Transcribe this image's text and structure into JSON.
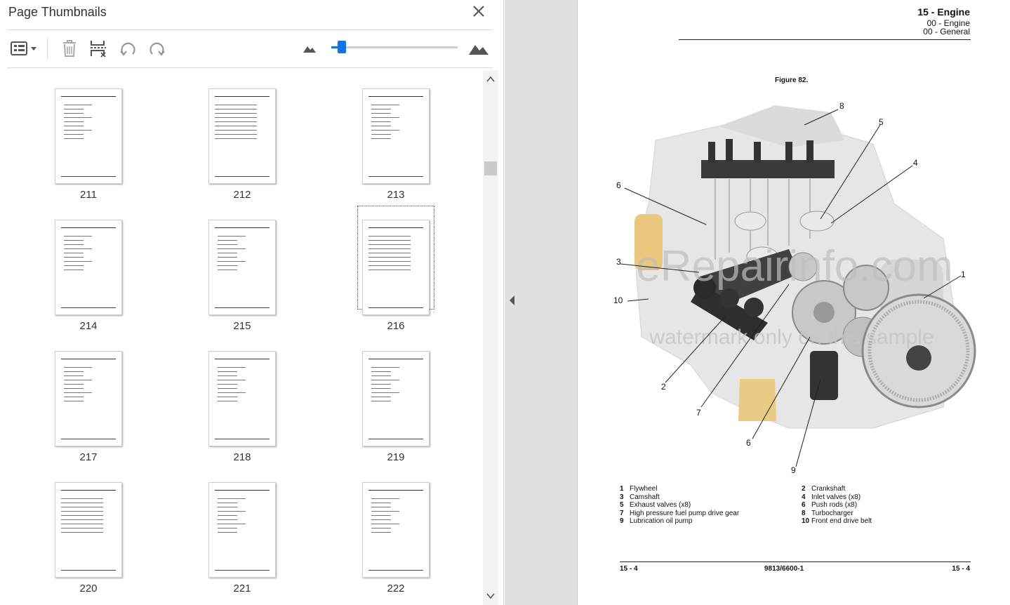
{
  "panel": {
    "title": "Page Thumbnails",
    "thumbnails": [
      {
        "page": "211"
      },
      {
        "page": "212"
      },
      {
        "page": "213"
      },
      {
        "page": "214"
      },
      {
        "page": "215"
      },
      {
        "page": "216",
        "selected": true
      },
      {
        "page": "217"
      },
      {
        "page": "218"
      },
      {
        "page": "219"
      },
      {
        "page": "220"
      },
      {
        "page": "221"
      },
      {
        "page": "222"
      }
    ],
    "zoom_fraction": 0.05
  },
  "toolbar": {
    "icons": [
      "options-menu-icon",
      "delete-page-icon",
      "insert-page-icon",
      "rotate-left-icon",
      "rotate-right-icon",
      "zoom-out-mountain-icon",
      "zoom-in-mountain-icon"
    ]
  },
  "document": {
    "section_title": "15 - Engine",
    "sub1": "00 - Engine",
    "sub2": "00 - General",
    "figure_title": "Figure 82.",
    "watermark_1": "eRepairinfo.com",
    "watermark_2": "watermark only on this sample",
    "callouts": [
      "1",
      "2",
      "3",
      "4",
      "5",
      "6",
      "7",
      "8",
      "9",
      "10",
      "6"
    ],
    "legend": [
      {
        "n": "1",
        "text": "Flywheel"
      },
      {
        "n": "2",
        "text": "Crankshaft"
      },
      {
        "n": "3",
        "text": "Camshaft"
      },
      {
        "n": "4",
        "text": "Inlet valves (x8)"
      },
      {
        "n": "5",
        "text": "Exhaust valves (x8)"
      },
      {
        "n": "6",
        "text": "Push rods (x8)"
      },
      {
        "n": "7",
        "text": "High pressure fuel pump drive gear"
      },
      {
        "n": "8",
        "text": "Turbocharger"
      },
      {
        "n": "9",
        "text": "Lubrication oil pump"
      },
      {
        "n": "10",
        "text": "Front end drive belt"
      }
    ],
    "footer_left": "15 - 4",
    "footer_mid": "9813/6600-1",
    "footer_right": "15 - 4"
  },
  "colors": {
    "accent": "#1473e6",
    "gutter": "#e1e1e1"
  }
}
